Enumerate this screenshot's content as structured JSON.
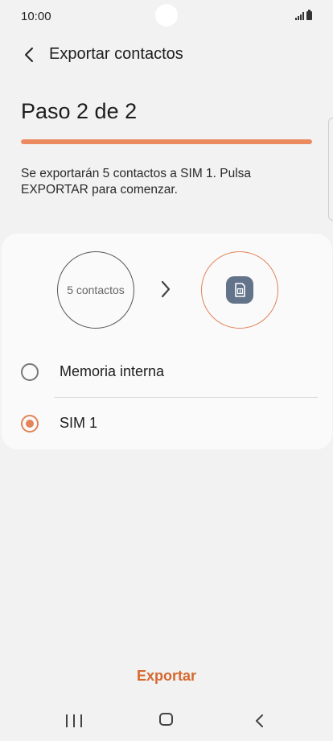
{
  "status_bar": {
    "time": "10:00"
  },
  "app_bar": {
    "title": "Exportar contactos"
  },
  "step": {
    "title": "Paso 2 de 2",
    "progress": 1.0
  },
  "description": "Se exportarán 5 contactos a SIM 1. Pulsa EXPORTAR para comenzar.",
  "export_card": {
    "source_label": "5 contactos",
    "options": [
      {
        "label": "Memoria interna",
        "selected": false
      },
      {
        "label": "SIM 1",
        "selected": true
      }
    ]
  },
  "footer": {
    "export_label": "Exportar"
  },
  "colors": {
    "accent": "#e2835a",
    "progress": "#ec8a5f",
    "button_text": "#d6682e",
    "sim_badge": "#63738a"
  },
  "icons": [
    "back-arrow-icon",
    "chevron-right-icon",
    "sim-card-icon",
    "signal-icon",
    "battery-icon",
    "recents-icon",
    "home-icon",
    "nav-back-icon"
  ]
}
